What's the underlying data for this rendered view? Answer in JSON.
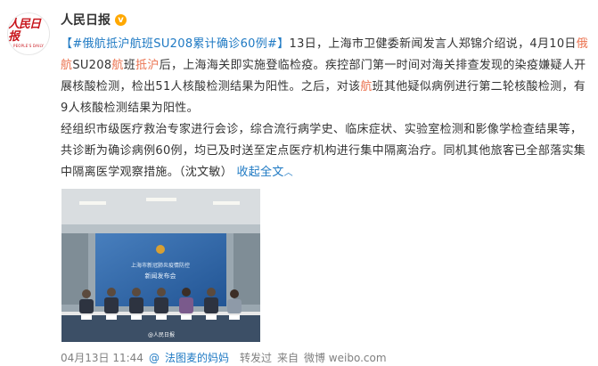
{
  "user": {
    "name": "人民日报",
    "verified_badge": "v",
    "avatar_logo_cn": "人民日报",
    "avatar_logo_en": "PEOPLE'S DAILY"
  },
  "post": {
    "topic_open": "【",
    "topic": "#俄航抵沪航班SU208累计确诊60例#",
    "topic_close": "】",
    "p1_a": "13日，上海市卫健委新闻发言人郑锦介绍说，4月10日",
    "p1_kw1": "俄航",
    "p1_b": "SU208",
    "p1_kw2": "航",
    "p1_c": "班",
    "p1_kw3": "抵沪",
    "p1_d": "后，上海海关即实施登临检疫。疾控部门第一时间对海关排查发现的染疫嫌疑人开展核酸检测，检出51人核酸检测结果为阳性。之后，对该",
    "p1_kw4": "航",
    "p1_e": "班其他疑似病例进行第二轮核酸检测，有9人核酸检测结果为阳性。",
    "p2": "经组织市级医疗救治专家进行会诊，综合流行病学史、临床症状、实验室检测和影像学检查结果等，共诊断为确诊病例60例，均已及时送至定点医疗机构进行集中隔离治疗。同机其他旅客已全部落实集中隔离医学观察措施。（沈文敏）",
    "collapse_label": "收起全文",
    "collapse_arrow": "︿"
  },
  "photo": {
    "screen_line1": "上海市新冠肺炎疫情防控",
    "screen_line2": "新闻发布会",
    "watermark": "@人民日报"
  },
  "footer": {
    "date": "04月13日 11:44",
    "author_prefix": "@",
    "author": "法图麦的妈妈",
    "action": "转发过",
    "source_prefix": "来自",
    "source": "微博 weibo.com"
  },
  "colors": {
    "keyword": "#eb7350",
    "link": "#1e79c3",
    "badge": "#ffa800",
    "logo": "#c8161d"
  }
}
